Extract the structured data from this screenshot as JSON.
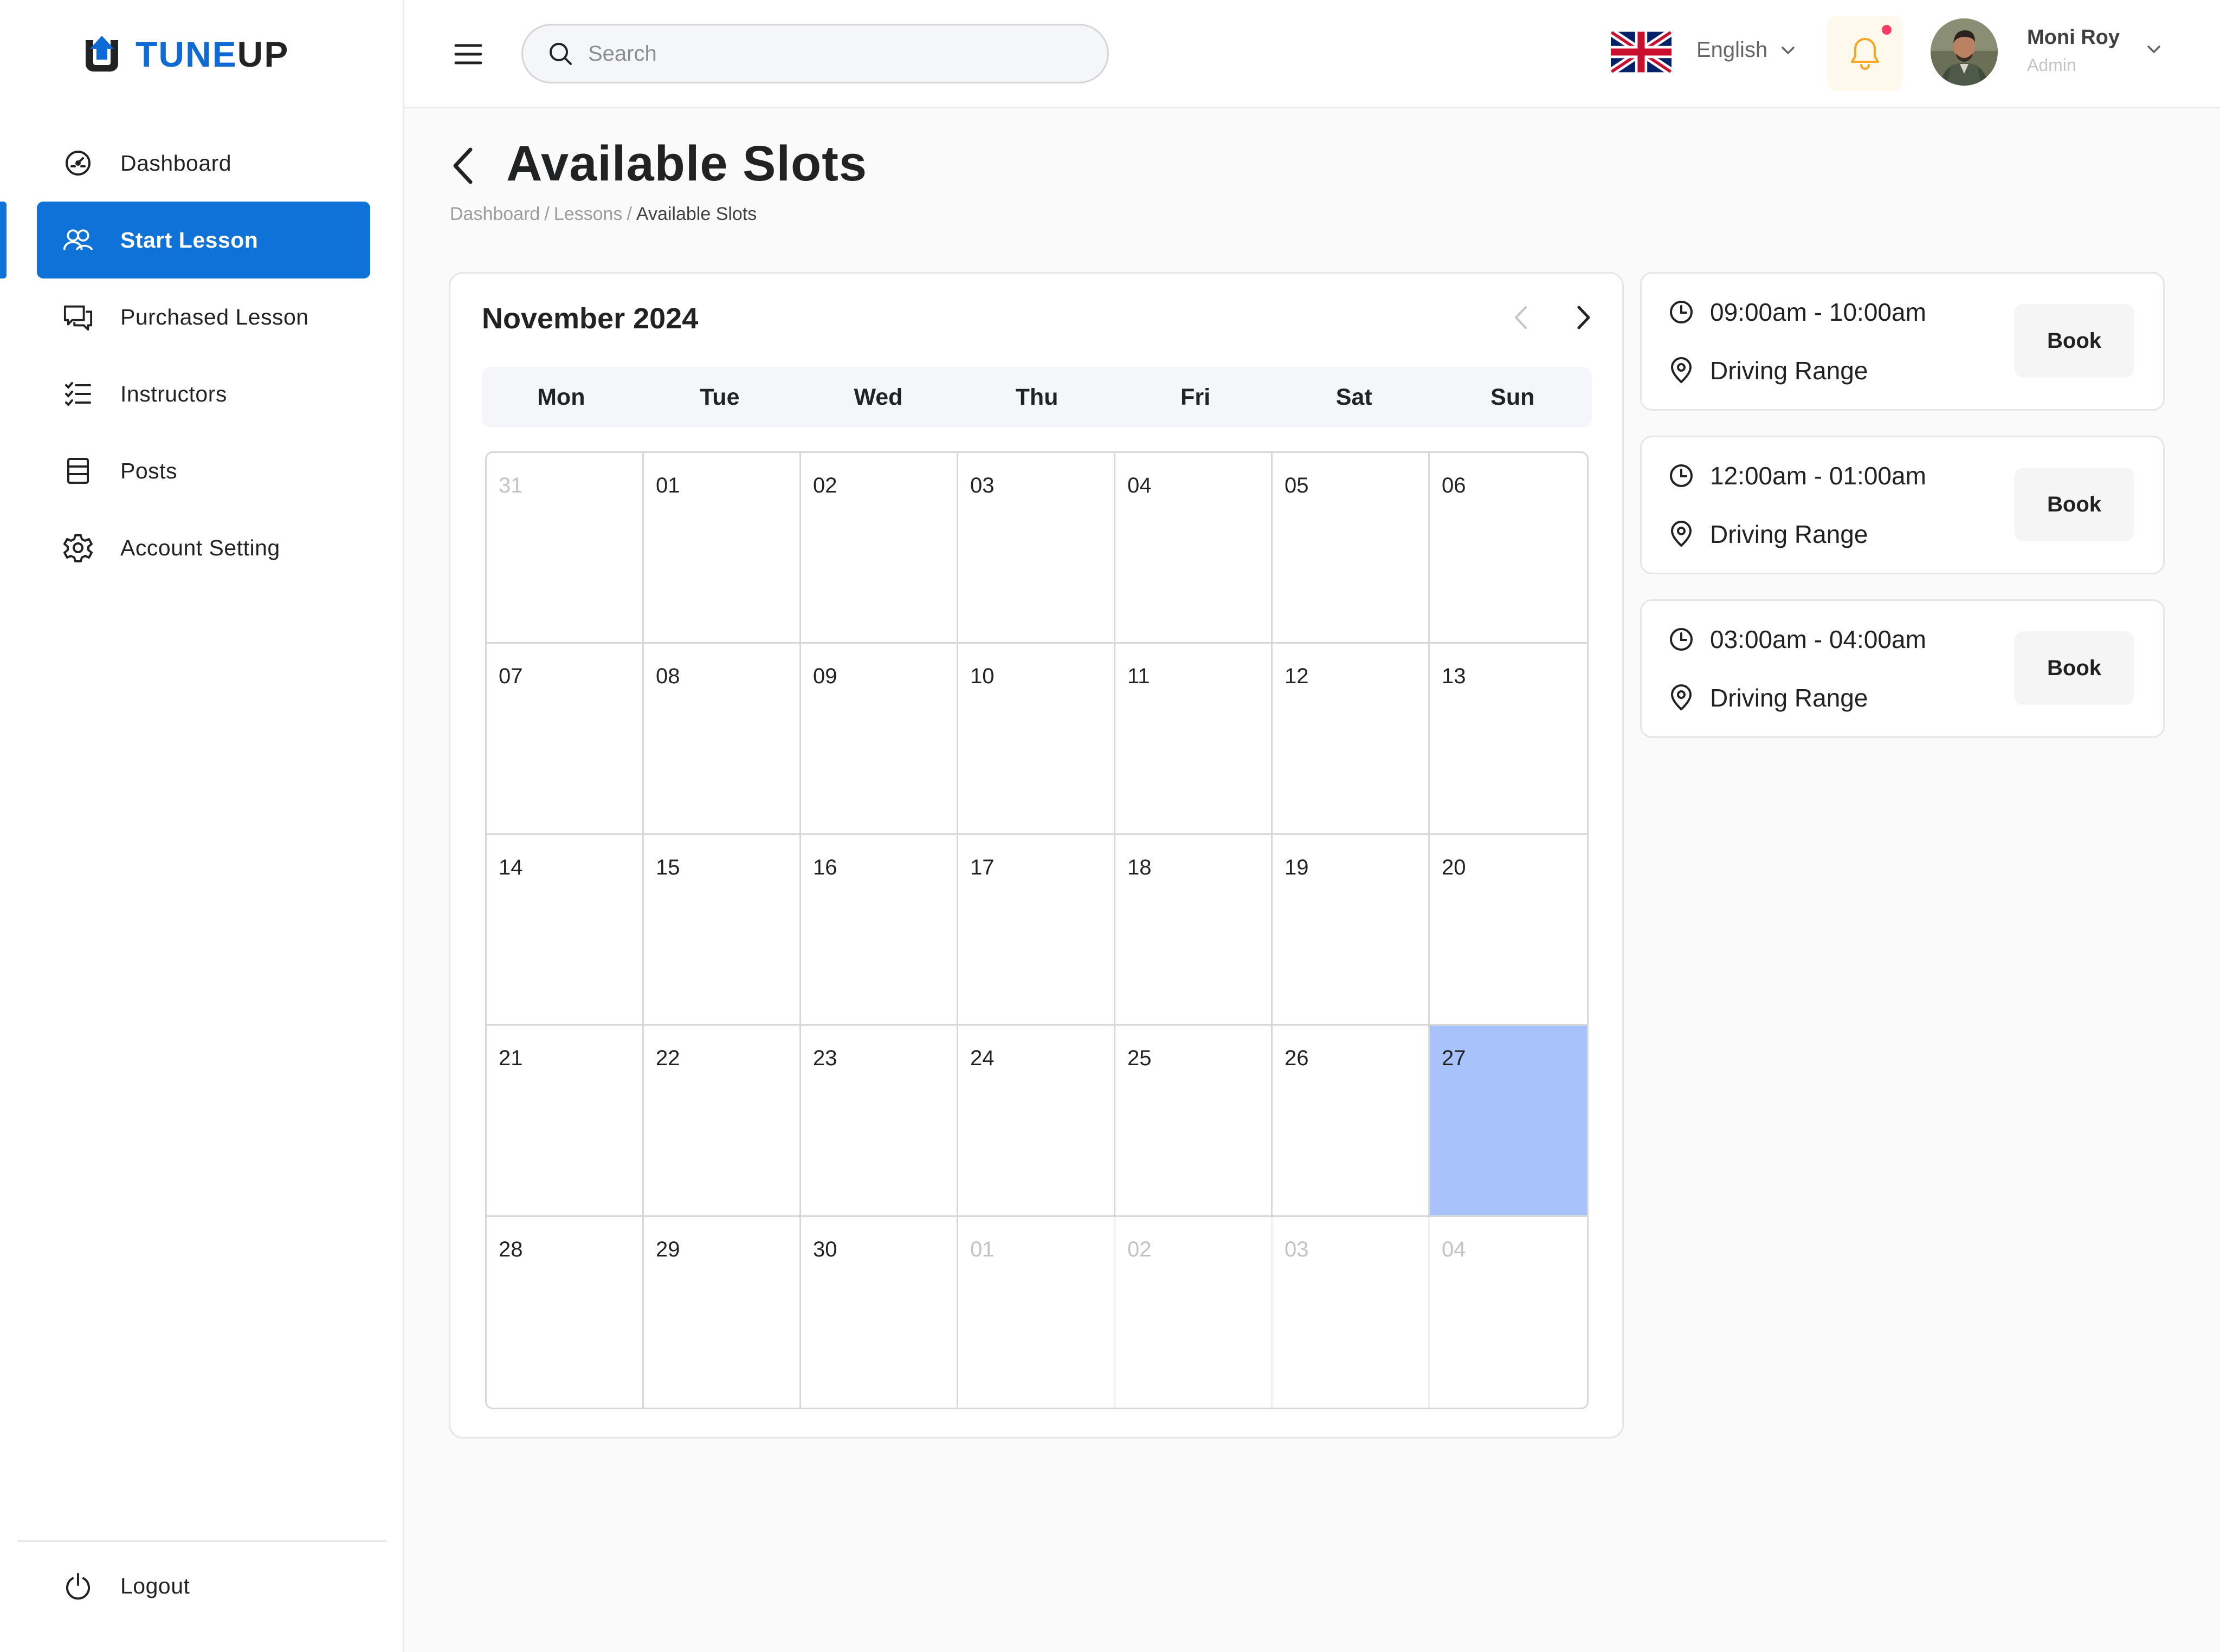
{
  "brand": {
    "name_part1": "TUNE",
    "name_part2": "UP",
    "color": "#0f6ad4"
  },
  "sidebar": {
    "items": [
      {
        "label": "Dashboard",
        "icon": "dashboard-gauge-icon"
      },
      {
        "label": "Start Lesson",
        "icon": "users-icon",
        "active": true
      },
      {
        "label": "Purchased Lesson",
        "icon": "chat-bubbles-icon"
      },
      {
        "label": "Instructors",
        "icon": "checklist-icon"
      },
      {
        "label": "Posts",
        "icon": "posts-list-icon"
      },
      {
        "label": "Account Setting",
        "icon": "gear-icon"
      }
    ],
    "logout": {
      "label": "Logout",
      "icon": "power-icon"
    }
  },
  "header": {
    "search_placeholder": "Search",
    "language": "English",
    "user": {
      "name": "Moni Roy",
      "role": "Admin"
    }
  },
  "page": {
    "title": "Available Slots",
    "breadcrumb": [
      "Dashboard",
      "Lessons",
      "Available Slots"
    ]
  },
  "calendar": {
    "month_label": "November 2024",
    "weekdays": [
      "Mon",
      "Tue",
      "Wed",
      "Thu",
      "Fri",
      "Sat",
      "Sun"
    ],
    "days": [
      {
        "label": "31",
        "outside": true
      },
      {
        "label": "01"
      },
      {
        "label": "02"
      },
      {
        "label": "03"
      },
      {
        "label": "04"
      },
      {
        "label": "05"
      },
      {
        "label": "06"
      },
      {
        "label": "07"
      },
      {
        "label": "08"
      },
      {
        "label": "09"
      },
      {
        "label": "10"
      },
      {
        "label": "11"
      },
      {
        "label": "12"
      },
      {
        "label": "13"
      },
      {
        "label": "14"
      },
      {
        "label": "15"
      },
      {
        "label": "16"
      },
      {
        "label": "17"
      },
      {
        "label": "18"
      },
      {
        "label": "19"
      },
      {
        "label": "20"
      },
      {
        "label": "21"
      },
      {
        "label": "22"
      },
      {
        "label": "23"
      },
      {
        "label": "24"
      },
      {
        "label": "25"
      },
      {
        "label": "26"
      },
      {
        "label": "27",
        "selected": true
      },
      {
        "label": "28"
      },
      {
        "label": "29"
      },
      {
        "label": "30"
      },
      {
        "label": "01",
        "outside": true
      },
      {
        "label": "02",
        "outside": true
      },
      {
        "label": "03",
        "outside": true
      },
      {
        "label": "04",
        "outside": true
      }
    ],
    "selected_color": "#a8c2fb"
  },
  "slots": [
    {
      "time": "09:00am - 10:00am",
      "location": "Driving Range",
      "button": "Book"
    },
    {
      "time": "12:00am - 01:00am",
      "location": "Driving Range",
      "button": "Book"
    },
    {
      "time": "03:00am - 04:00am",
      "location": "Driving Range",
      "button": "Book"
    }
  ]
}
